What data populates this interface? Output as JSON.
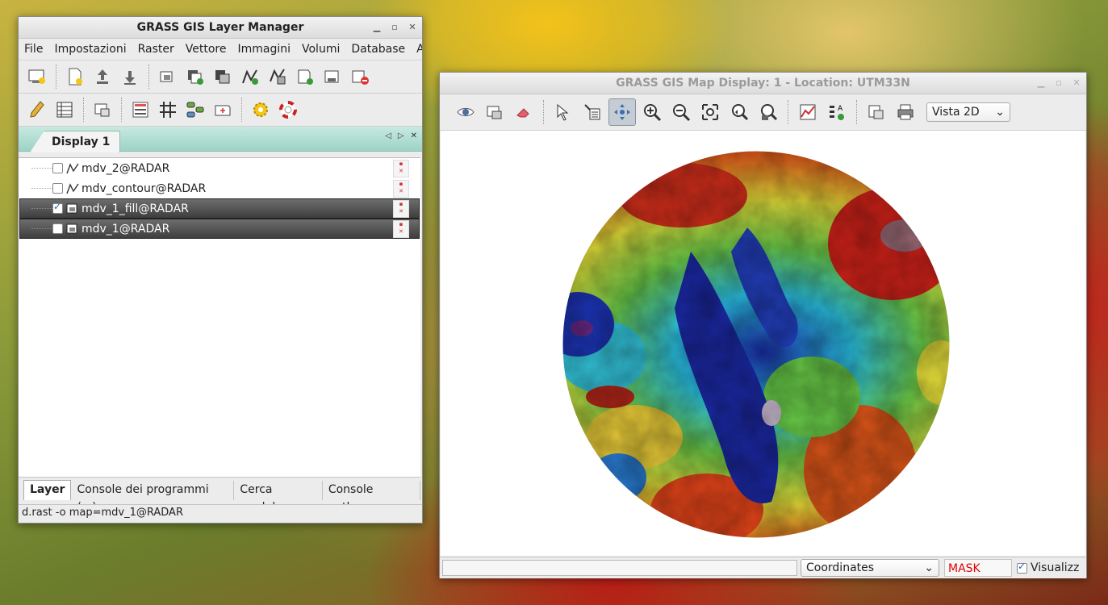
{
  "layer_manager": {
    "title": "GRASS GIS Layer Manager",
    "menu": [
      "File",
      "Impostazioni",
      "Raster",
      "Vettore",
      "Immagini",
      "Volumi",
      "Database",
      "Ai"
    ],
    "display_tab": "Display 1",
    "layers": [
      {
        "name": "mdv_2@RADAR",
        "type": "vector",
        "checked": false,
        "selected": false
      },
      {
        "name": "mdv_contour@RADAR",
        "type": "vector",
        "checked": false,
        "selected": false
      },
      {
        "name": "mdv_1_fill@RADAR",
        "type": "raster",
        "checked": true,
        "selected": true
      },
      {
        "name": "mdv_1@RADAR",
        "type": "raster",
        "checked": false,
        "selected": true
      }
    ],
    "bottom_tabs": [
      "Layer",
      "Console dei programmi (...)",
      "Cerca modulo",
      "Console python"
    ],
    "command": "d.rast -o map=mdv_1@RADAR"
  },
  "map_display": {
    "title": "GRASS GIS Map Display: 1 - Location: UTM33N",
    "view_select": "Vista 2D",
    "coordinates_select": "Coordinates",
    "mask_label": "MASK",
    "render_label": "Visualizz"
  },
  "colors": {
    "mask_text": "#e00000",
    "selected_row": "#4a4a4a",
    "tab_strip": "#a8d9cc"
  }
}
